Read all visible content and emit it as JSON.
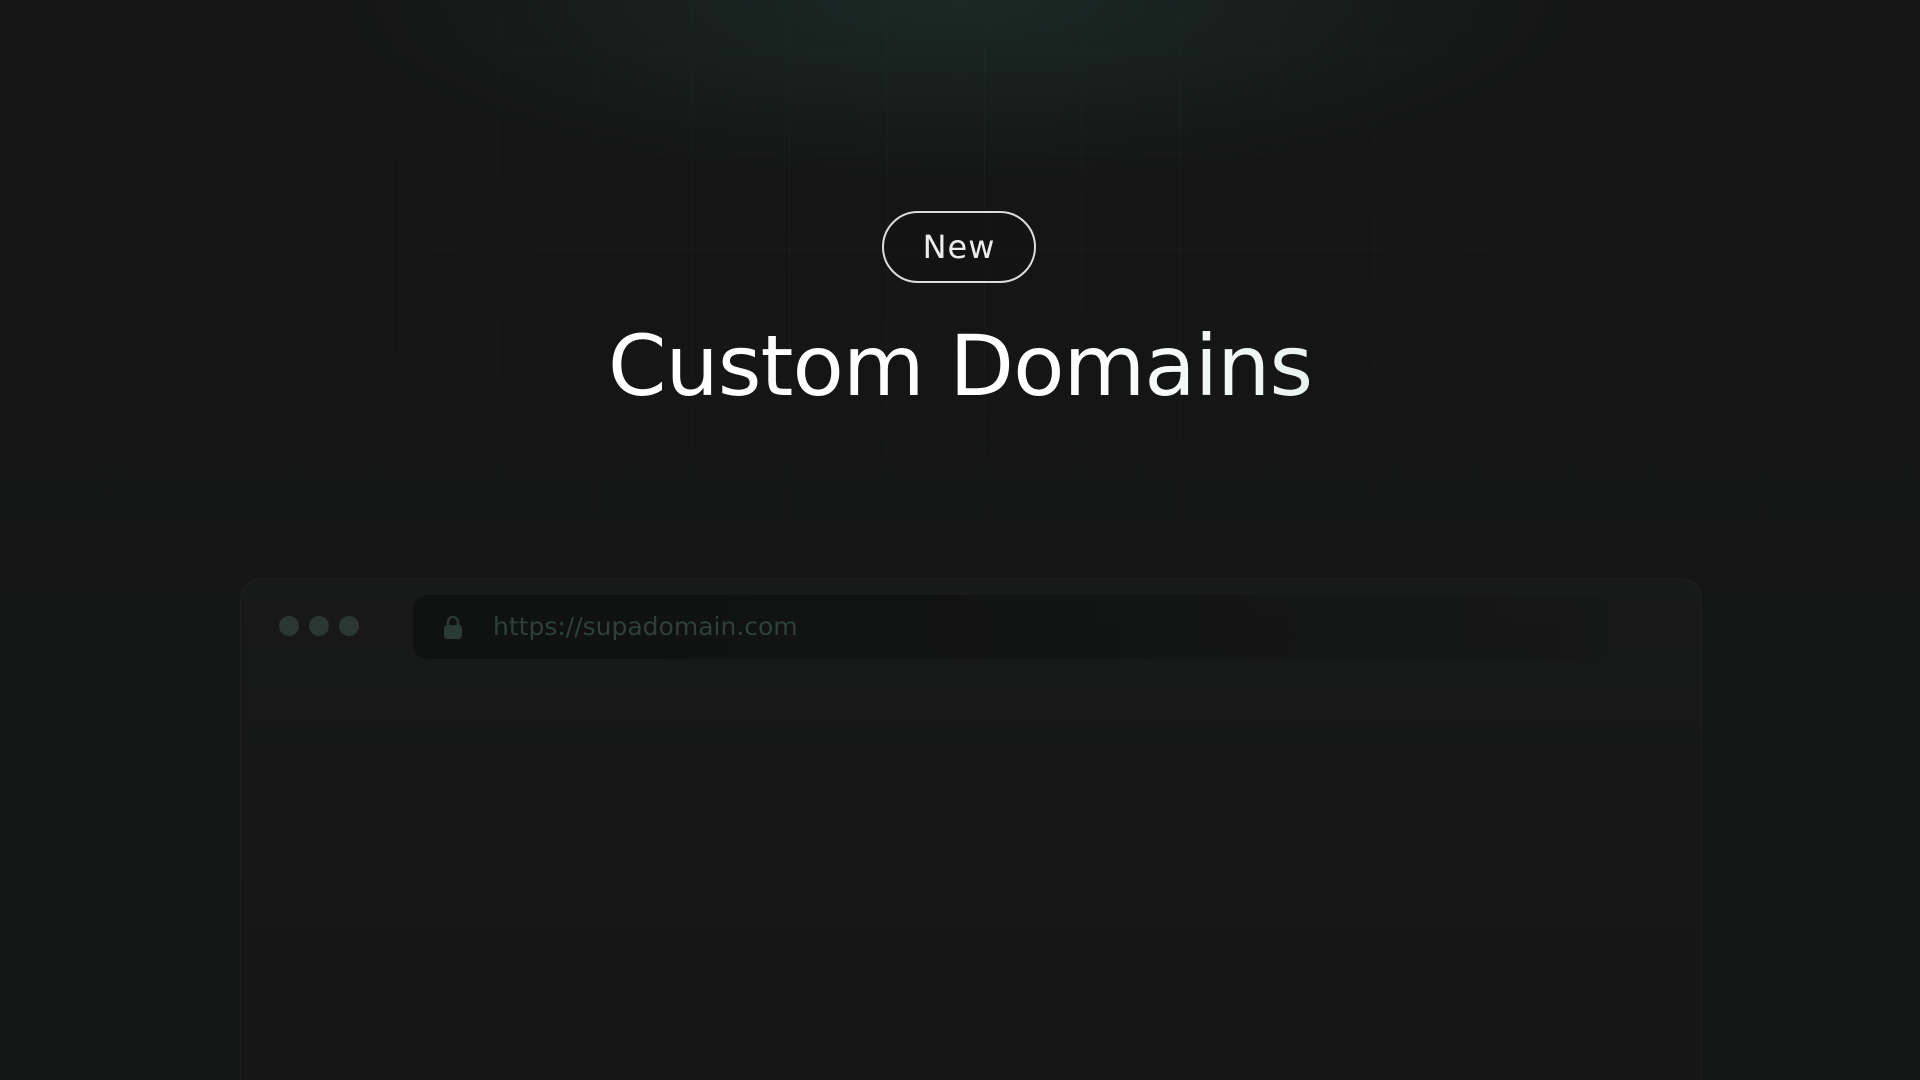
{
  "badge": {
    "label": "New"
  },
  "headline": {
    "title": "Custom Domains"
  },
  "browser": {
    "url": "https://supadomain.com",
    "icons": {
      "window_controls": [
        "dot-icon",
        "dot-icon",
        "dot-icon"
      ],
      "lock": "lock-icon"
    }
  },
  "colors": {
    "background": "#151515",
    "accent_glow": "#1e3a32",
    "badge_border": "#dcdcdc",
    "title_gradient_end": "#b8d6cb",
    "url_text": "#2c4239"
  }
}
